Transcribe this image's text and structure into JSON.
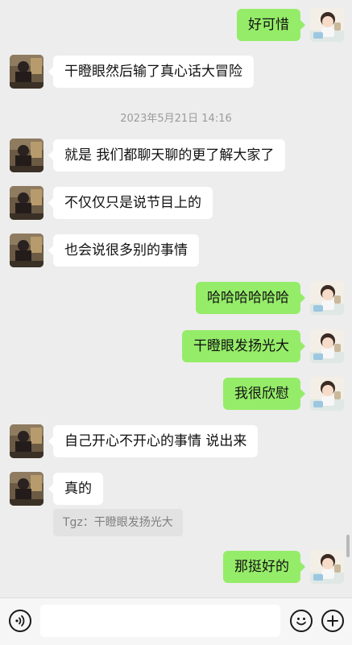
{
  "chat": {
    "timestamp": "2023年5月21日 14:16",
    "messages": [
      {
        "side": "right",
        "text": "好可惜"
      },
      {
        "side": "left",
        "text": "干瞪眼然后输了真心话大冒险"
      },
      {
        "side": "left",
        "text": "就是 我们都聊天聊的更了解大家了"
      },
      {
        "side": "left",
        "text": "不仅仅只是说节目上的"
      },
      {
        "side": "left",
        "text": "也会说很多别的事情"
      },
      {
        "side": "right",
        "text": "哈哈哈哈哈哈"
      },
      {
        "side": "right",
        "text": "干瞪眼发扬光大"
      },
      {
        "side": "right",
        "text": "我很欣慰"
      },
      {
        "side": "left",
        "text": "自己开心不开心的事情 说出来"
      },
      {
        "side": "left",
        "text": "真的"
      },
      {
        "side": "right",
        "text": "那挺好的"
      }
    ],
    "quote": "Tgz：干瞪眼发扬光大"
  },
  "input_bar": {
    "icons": [
      "voice-icon",
      "emoji-icon",
      "plus-icon"
    ],
    "text_value": ""
  },
  "colors": {
    "background": "#ededed",
    "sent_bubble": "#95ec69",
    "received_bubble": "#ffffff",
    "timestamp_text": "#9b9b9b"
  }
}
